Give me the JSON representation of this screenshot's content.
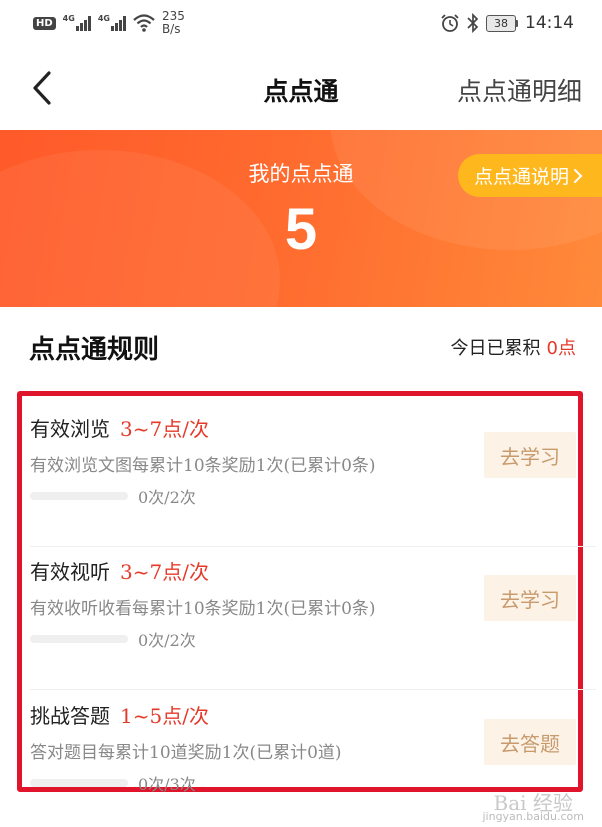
{
  "status_bar": {
    "hd": "HD",
    "net1": "4G",
    "net2": "4G",
    "speed_value": "235",
    "speed_unit": "B/s",
    "battery": "38",
    "time": "14:14"
  },
  "nav": {
    "title": "点点通",
    "detail_link": "点点通明细"
  },
  "banner": {
    "label": "我的点点通",
    "count": "5",
    "explain_button": "点点通说明"
  },
  "rules": {
    "title": "点点通规则",
    "today_label": "今日已累积",
    "today_value": "0点",
    "tasks": [
      {
        "name": "有效浏览",
        "points": "3~7点/次",
        "desc": "有效浏览文图每累计10条奖励1次(已累计0条)",
        "progress_text": "0次/2次",
        "progress_fraction": 0,
        "button": "去学习"
      },
      {
        "name": "有效视听",
        "points": "3~7点/次",
        "desc": "有效收听收看每累计10条奖励1次(已累计0条)",
        "progress_text": "0次/2次",
        "progress_fraction": 0,
        "button": "去学习"
      },
      {
        "name": "挑战答题",
        "points": "1~5点/次",
        "desc": "答对题目每累计10道奖励1次(已累计0道)",
        "progress_text": "0次/3次",
        "progress_fraction": 0,
        "button": "去答题"
      }
    ]
  },
  "watermark": {
    "logo": "Bai 经验",
    "url": "jingyan.baidu.com"
  },
  "colors": {
    "accent_red": "#e53a2a",
    "banner_orange": "#ff5a2a",
    "explain_yellow": "#ffb71e",
    "button_bg": "#fdf2e6",
    "button_text": "#c79b6e",
    "highlight_red": "#e0142a"
  }
}
